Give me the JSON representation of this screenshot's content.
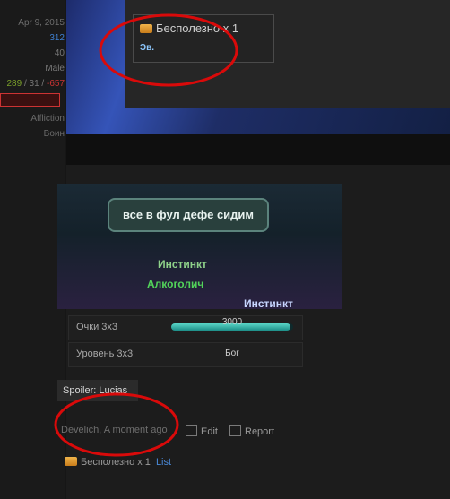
{
  "sidebar": {
    "date": "Apr 9, 2015",
    "messages": "312",
    "likes": "40",
    "gender": "Male",
    "votes": {
      "positive": "289",
      "neutral": "31",
      "negative": "-657"
    },
    "build": "Affliction",
    "class": "Воин"
  },
  "tooltip": {
    "title": "Бесполезно х 1",
    "user": "Эв."
  },
  "game": {
    "bubble_text": "все в фул дефе сидим",
    "labels": [
      "Инстинкт",
      "Алкоголич",
      "Инстинкт"
    ]
  },
  "profile": {
    "score_label": "Очки 3х3",
    "score_value": "3000",
    "score_fill": 0.98,
    "level_label": "Уровень 3х3",
    "level_value": "Бог"
  },
  "post": {
    "spoiler_label": "Spoiler: Lucias",
    "author_time": "Develich, A moment ago",
    "edit_label": "Edit",
    "report_label": "Report",
    "rating_text": "Бесполезно х 1",
    "list_label": "List"
  },
  "colors": {
    "accent": "#4a88d6",
    "marker": "#d90a0a",
    "score_bar": "#3fbfb3"
  }
}
